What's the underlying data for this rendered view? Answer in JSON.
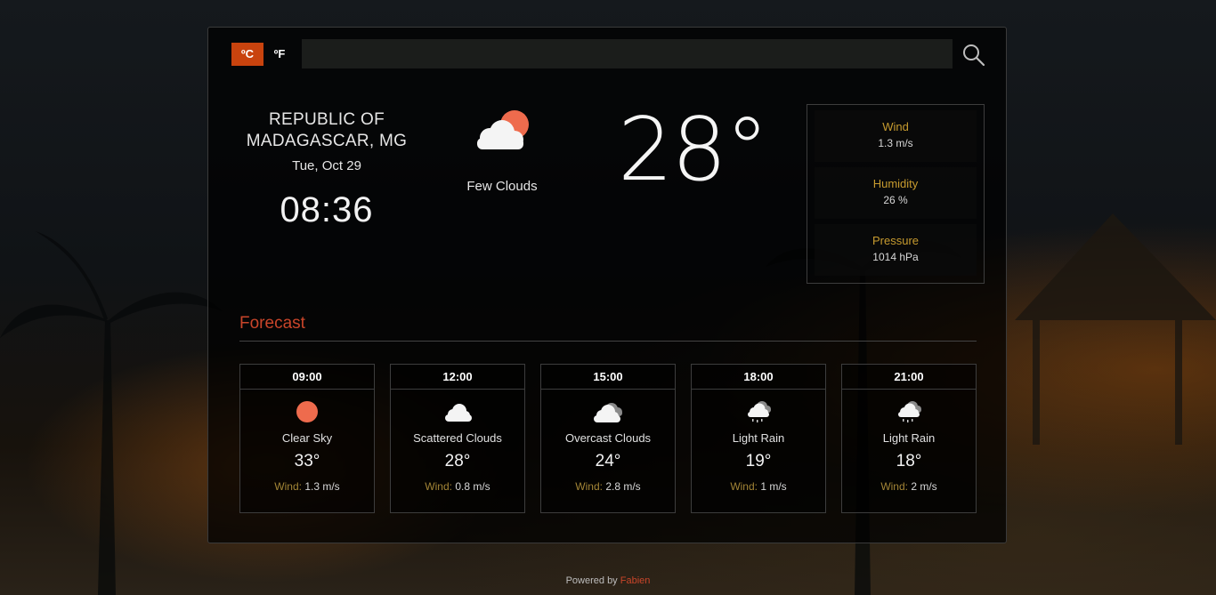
{
  "units": {
    "celsius": "ºC",
    "fahrenheit": "ºF",
    "active": "celsius"
  },
  "search": {
    "value": "",
    "placeholder": ""
  },
  "location": {
    "name": "REPUBLIC OF MADAGASCAR, MG",
    "date": "Tue, Oct 29",
    "time": "08:36"
  },
  "current": {
    "icon": "few-clouds-icon",
    "description": "Few Clouds",
    "temperature": "28°"
  },
  "stats": {
    "wind_label": "Wind",
    "wind_value": "1.3 m/s",
    "humidity_label": "Humidity",
    "humidity_value": "26 %",
    "pressure_label": "Pressure",
    "pressure_value": "1014 hPa"
  },
  "forecast": {
    "title": "Forecast",
    "wind_label": "Wind:",
    "items": [
      {
        "time": "09:00",
        "icon": "clear-sky-icon",
        "description": "Clear Sky",
        "temp": "33°",
        "wind": "1.3 m/s"
      },
      {
        "time": "12:00",
        "icon": "scattered-clouds-icon",
        "description": "Scattered Clouds",
        "temp": "28°",
        "wind": "0.8 m/s"
      },
      {
        "time": "15:00",
        "icon": "overcast-clouds-icon",
        "description": "Overcast Clouds",
        "temp": "24°",
        "wind": "2.8 m/s"
      },
      {
        "time": "18:00",
        "icon": "light-rain-icon",
        "description": "Light Rain",
        "temp": "19°",
        "wind": "1 m/s"
      },
      {
        "time": "21:00",
        "icon": "light-rain-icon",
        "description": "Light Rain",
        "temp": "18°",
        "wind": "2 m/s"
      }
    ]
  },
  "footer": {
    "text": "Powered by",
    "author": "Fabien"
  },
  "colors": {
    "accent": "#c9430e",
    "label_gold": "#c79b2f",
    "sun": "#ee6b4d"
  }
}
